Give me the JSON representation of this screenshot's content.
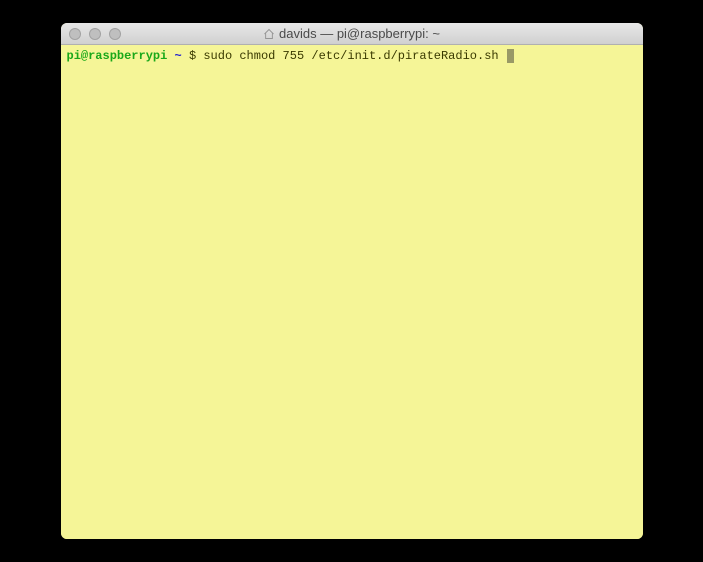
{
  "window": {
    "title": "davids — pi@raspberrypi: ~"
  },
  "terminal": {
    "prompt": {
      "user_host": "pi@raspberrypi",
      "path": "~",
      "symbol": "$"
    },
    "command": "sudo chmod 755 /etc/init.d/pirateRadio.sh"
  }
}
